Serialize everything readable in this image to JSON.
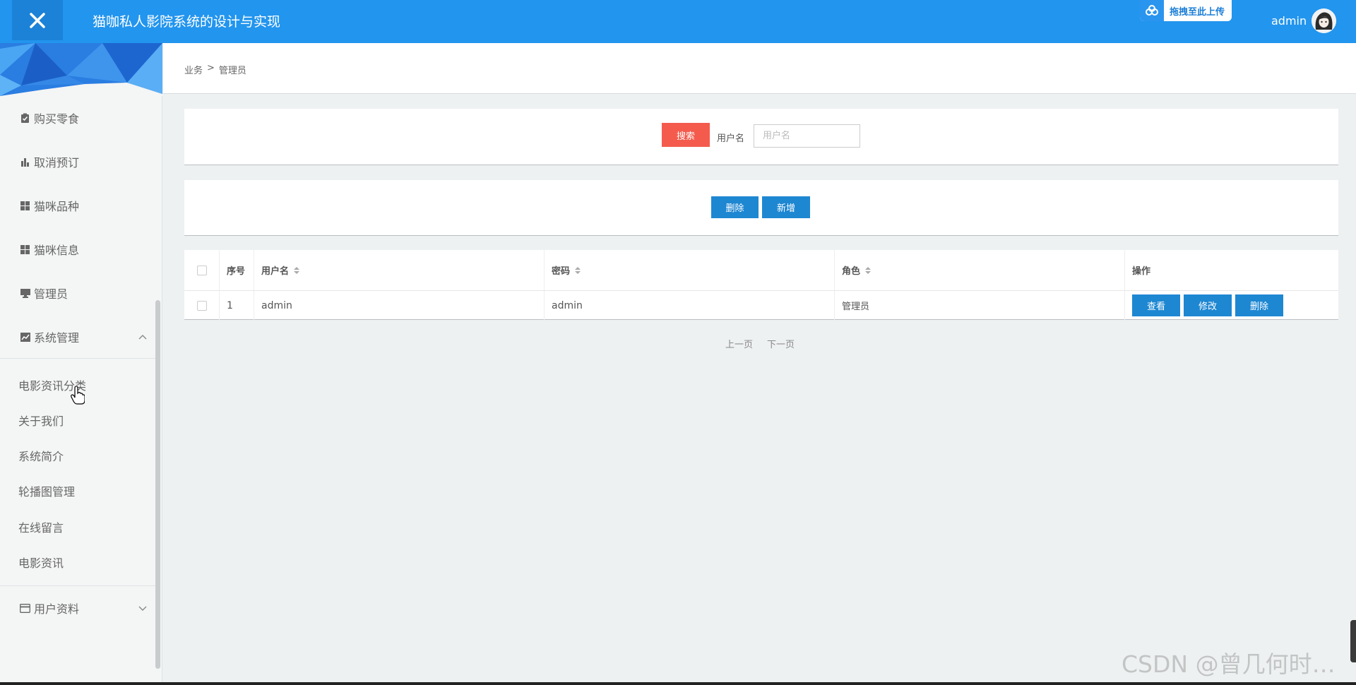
{
  "header": {
    "close_icon": "close-icon",
    "title": "猫咖私人影院系统的设计与实现",
    "upload_label": "拖拽至此上传",
    "username": "admin"
  },
  "sidebar": {
    "items": [
      {
        "label": "购买零食",
        "icon": "clipboard-check-icon"
      },
      {
        "label": "取消预订",
        "icon": "bar-chart-icon"
      },
      {
        "label": "猫咪品种",
        "icon": "grid-icon"
      },
      {
        "label": "猫咪信息",
        "icon": "grid-icon"
      },
      {
        "label": "管理员",
        "icon": "monitor-icon"
      },
      {
        "label": "系统管理",
        "icon": "line-chart-icon",
        "expanded": true
      }
    ],
    "sub_items": [
      "电影资讯分类",
      "关于我们",
      "系统简介",
      "轮播图管理",
      "在线留言",
      "电影资讯"
    ],
    "user_section": {
      "label": "用户资料",
      "icon": "card-icon",
      "expanded": false
    }
  },
  "breadcrumb": {
    "parent": "业务",
    "separator": ">",
    "current": "管理员"
  },
  "search": {
    "button": "搜索",
    "label": "用户名",
    "placeholder": "用户名",
    "value": ""
  },
  "actions": {
    "delete": "删除",
    "add": "新增"
  },
  "table": {
    "headers": [
      "序号",
      "用户名",
      "密码",
      "角色",
      "操作"
    ],
    "rows": [
      {
        "index": "1",
        "username": "admin",
        "password": "admin",
        "role": "管理员"
      }
    ],
    "row_actions": {
      "view": "查看",
      "edit": "修改",
      "delete": "删除"
    }
  },
  "pager": {
    "prev": "上一页",
    "next": "下一页"
  },
  "watermark": "CSDN @曾几何时…",
  "colors": {
    "header_bg": "#2295ee",
    "search_button": "#f45b4d",
    "action_button": "#1e87d2"
  }
}
